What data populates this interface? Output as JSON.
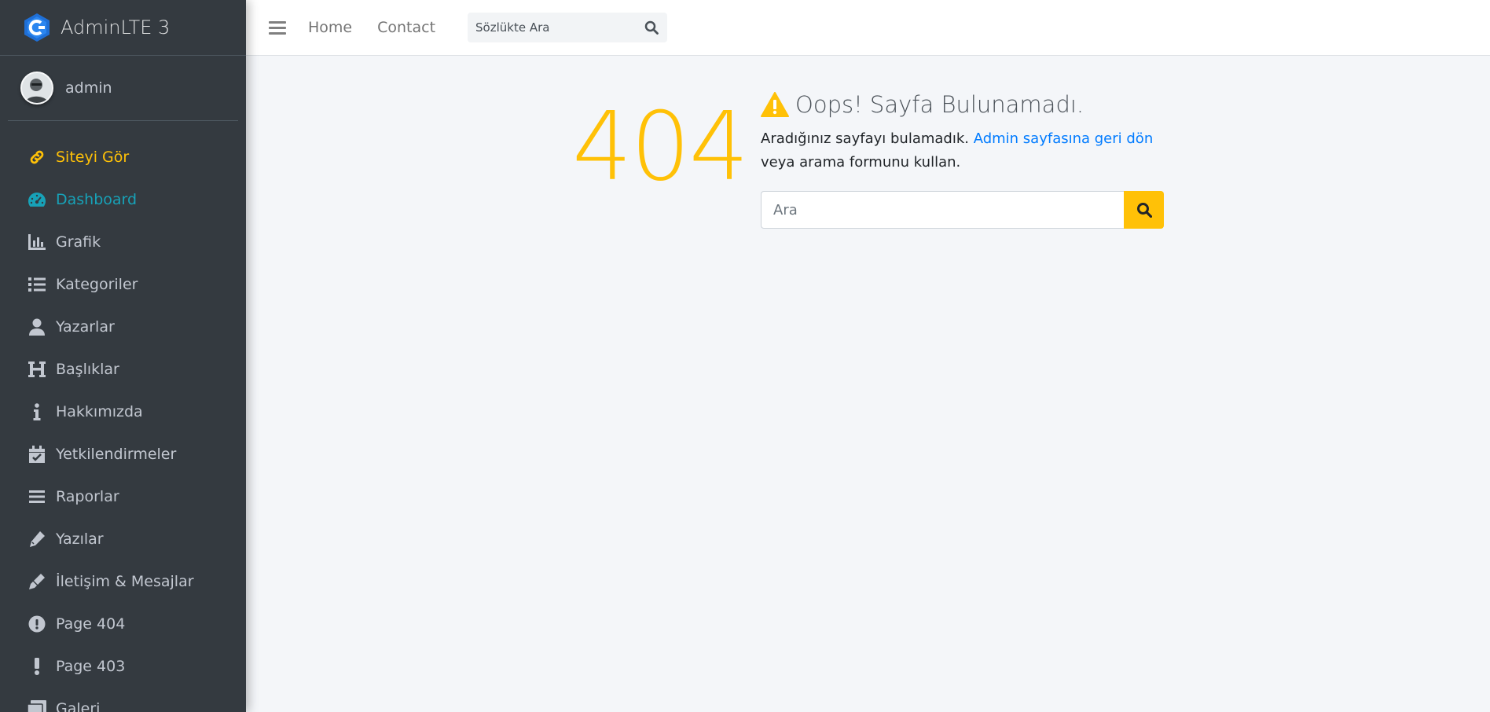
{
  "brand": {
    "name": "AdminLTE 3",
    "logo_icon": "adminlte-logo-icon"
  },
  "user": {
    "name": "admin",
    "avatar_icon": "user-avatar"
  },
  "sidebar": {
    "items": [
      {
        "label": "Siteyi Gör",
        "icon": "link-icon",
        "state": "highlight"
      },
      {
        "label": "Dashboard",
        "icon": "gauge-icon",
        "state": "active"
      },
      {
        "label": "Grafik",
        "icon": "chart-bar-icon",
        "state": ""
      },
      {
        "label": "Kategoriler",
        "icon": "list-icon",
        "state": ""
      },
      {
        "label": "Yazarlar",
        "icon": "user-icon",
        "state": ""
      },
      {
        "label": "Başlıklar",
        "icon": "heading-icon",
        "state": ""
      },
      {
        "label": "Hakkımızda",
        "icon": "info-icon",
        "state": ""
      },
      {
        "label": "Yetkilendirmeler",
        "icon": "calendar-check-icon",
        "state": ""
      },
      {
        "label": "Raporlar",
        "icon": "bars-icon",
        "state": ""
      },
      {
        "label": "Yazılar",
        "icon": "pen-icon",
        "state": ""
      },
      {
        "label": "İletişim & Mesajlar",
        "icon": "pen-fancy-icon",
        "state": ""
      },
      {
        "label": "Page 404",
        "icon": "exclamation-circle-icon",
        "state": ""
      },
      {
        "label": "Page 403",
        "icon": "exclamation-icon",
        "state": ""
      },
      {
        "label": "Galeri",
        "icon": "images-icon",
        "state": ""
      }
    ]
  },
  "navbar": {
    "links": [
      "Home",
      "Contact"
    ],
    "search_placeholder": "Sözlükte Ara"
  },
  "error": {
    "code": "404",
    "title": "Oops! Sayfa Bulunamadı.",
    "text_before": "Aradığınız sayfayı bulamadık. ",
    "link_text": "Admin sayfasına geri dön",
    "text_after": " veya arama formunu kullan.",
    "search_placeholder": "Ara"
  },
  "colors": {
    "sidebar_bg": "#343a40",
    "warning": "#ffc107",
    "info": "#17a2b8",
    "link": "#007bff"
  }
}
